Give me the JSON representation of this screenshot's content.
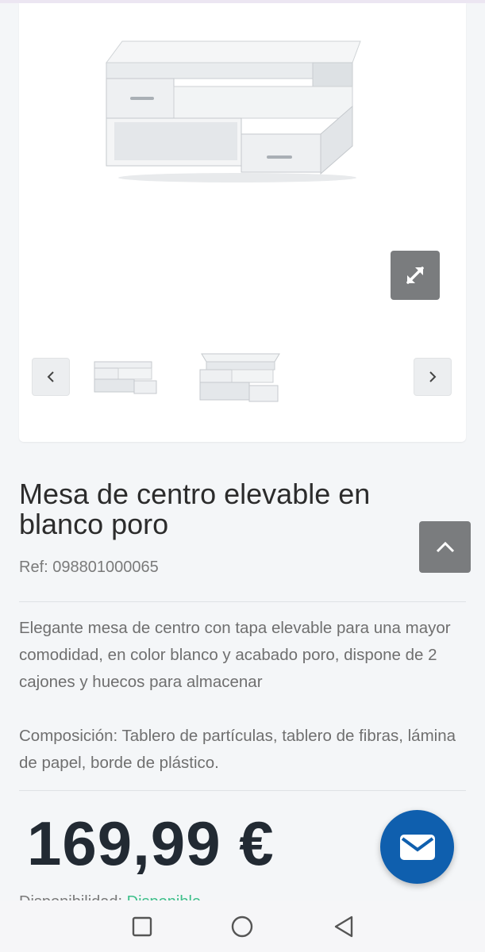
{
  "gallery": {
    "main_image": "white lift-top coffee table with two drawers",
    "thumbnails": [
      "coffee table closed",
      "coffee table with raised top"
    ],
    "zoom_icon": "expand-diagonal-icon",
    "prev_icon": "chevron-left-icon",
    "next_icon": "chevron-right-icon"
  },
  "product": {
    "title": "Mesa de centro elevable en blanco poro",
    "ref": "Ref: 098801000065",
    "description": "Elegante mesa de centro con tapa elevable para una mayor comodidad, en color blanco y acabado poro, dispone de 2 cajones y huecos para almacenar",
    "composition": "Composición: Tablero de partículas, tablero de fibras, lámina de papel, borde de plástico.",
    "price": "169,99 €",
    "availability_label": "Disponibilidad: ",
    "availability_value": "Disponible"
  },
  "actions": {
    "scroll_top_icon": "chevron-up-icon",
    "contact_icon": "mail-icon"
  },
  "system_nav": {
    "recents_icon": "square-icon",
    "home_icon": "circle-icon",
    "back_icon": "triangle-back-icon"
  },
  "colors": {
    "accent_blue": "#0f5fae",
    "button_gray": "#7a7c7e",
    "price_dark": "#222a33",
    "available_green": "#3dbf8a"
  }
}
